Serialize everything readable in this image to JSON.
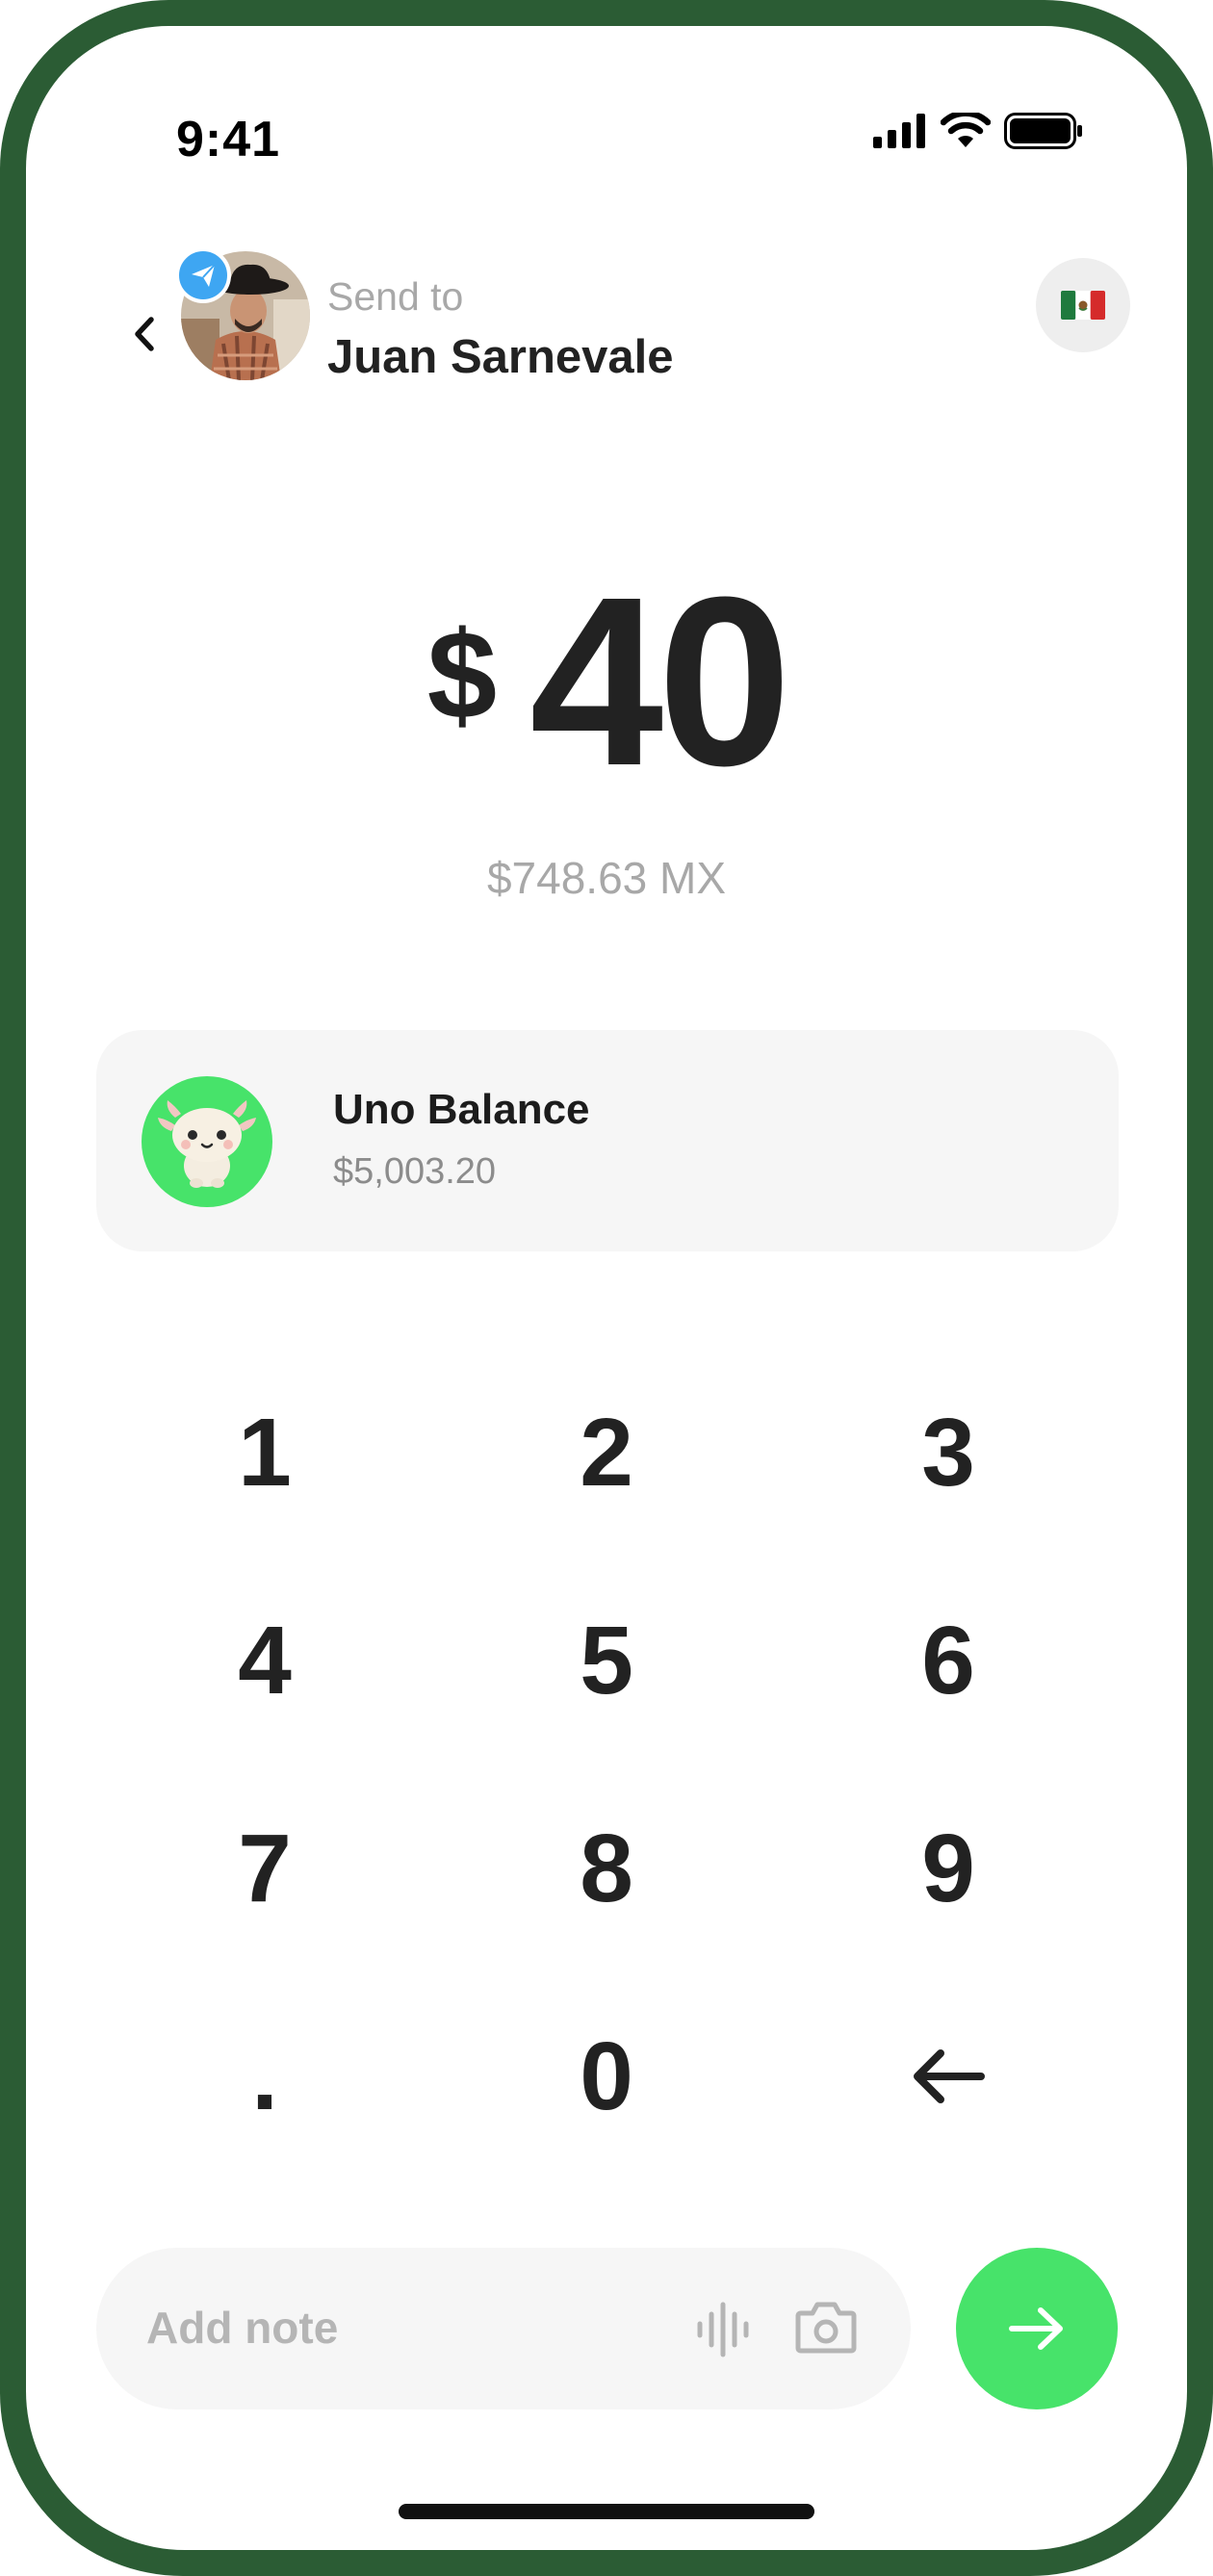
{
  "status_bar": {
    "time": "9:41"
  },
  "header": {
    "subtitle": "Send to",
    "recipient_name": "Juan Sarnevale",
    "avatar_badge_icon": "paper-plane-icon",
    "currency_flag": "mexico-flag-icon"
  },
  "amount": {
    "currency_symbol": "$",
    "value": "40",
    "converted": "$748.63 MX"
  },
  "funding_source": {
    "title": "Uno Balance",
    "balance": "$5,003.20",
    "icon": "axolotl-mascot-icon"
  },
  "keypad": {
    "keys": [
      "1",
      "2",
      "3",
      "4",
      "5",
      "6",
      "7",
      "8",
      "9",
      ".",
      "0"
    ],
    "backspace_icon": "arrow-left-icon"
  },
  "note": {
    "placeholder": "Add note",
    "voice_icon": "voice-waveform-icon",
    "camera_icon": "camera-icon"
  },
  "send_button": {
    "icon": "arrow-right-icon"
  },
  "colors": {
    "frame": "#2b5c34",
    "accent": "#47e36a",
    "badge": "#3ea6f2",
    "text_primary": "#222222",
    "text_secondary": "#a8a8a8",
    "card_bg": "#f6f6f6"
  }
}
